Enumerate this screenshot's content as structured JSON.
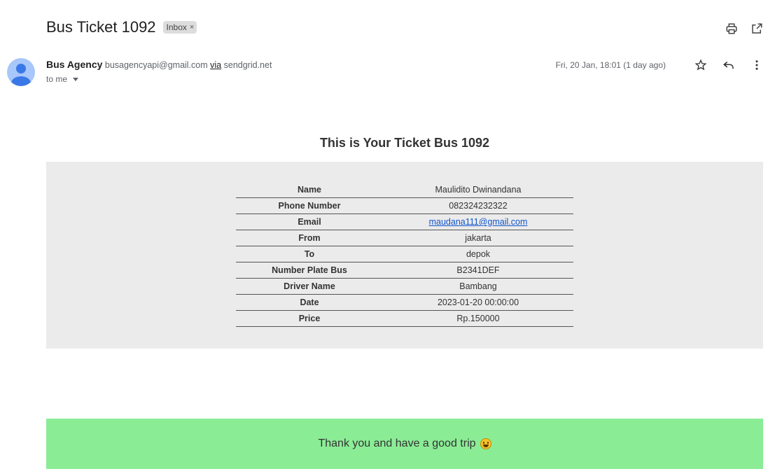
{
  "header": {
    "subject": "Bus Ticket 1092",
    "label": "Inbox",
    "label_remove": "×"
  },
  "message": {
    "sender_name": "Bus Agency",
    "sender_email": "busagencyapi@gmail.com",
    "via": "via",
    "via_domain": "sendgrid.net",
    "to": "to me",
    "date": "Fri, 20 Jan, 18:01 (1 day ago)"
  },
  "icons": {
    "print": "print-icon",
    "open_new_window": "open-in-new-window-icon",
    "star": "star-icon",
    "reply": "reply-icon",
    "more": "more-vert-icon",
    "avatar": "avatar-person-icon",
    "to_details": "chevron-down-icon",
    "emoji": "grinning-face-emoji"
  },
  "body": {
    "title": "This is Your Ticket Bus 1092",
    "rows": [
      {
        "label": "Name",
        "value": "Maulidito Dwinandana"
      },
      {
        "label": "Phone Number",
        "value": "082324232322"
      },
      {
        "label": "Email",
        "value": "maudana111@gmail.com"
      },
      {
        "label": "From",
        "value": "jakarta"
      },
      {
        "label": "To",
        "value": "depok"
      },
      {
        "label": "Number Plate Bus",
        "value": "B2341DEF"
      },
      {
        "label": "Driver Name",
        "value": "Bambang"
      },
      {
        "label": "Date",
        "value": "2023-01-20 00:00:00"
      },
      {
        "label": "Price",
        "value": "Rp.150000"
      }
    ],
    "footer": "Thank you and have a good trip"
  },
  "colors": {
    "panel_bg": "#ebebeb",
    "footer_bg": "#8bec96",
    "link": "#1155cc",
    "avatar_bg": "#a8c7fa",
    "avatar_fg": "#3b78e7"
  }
}
